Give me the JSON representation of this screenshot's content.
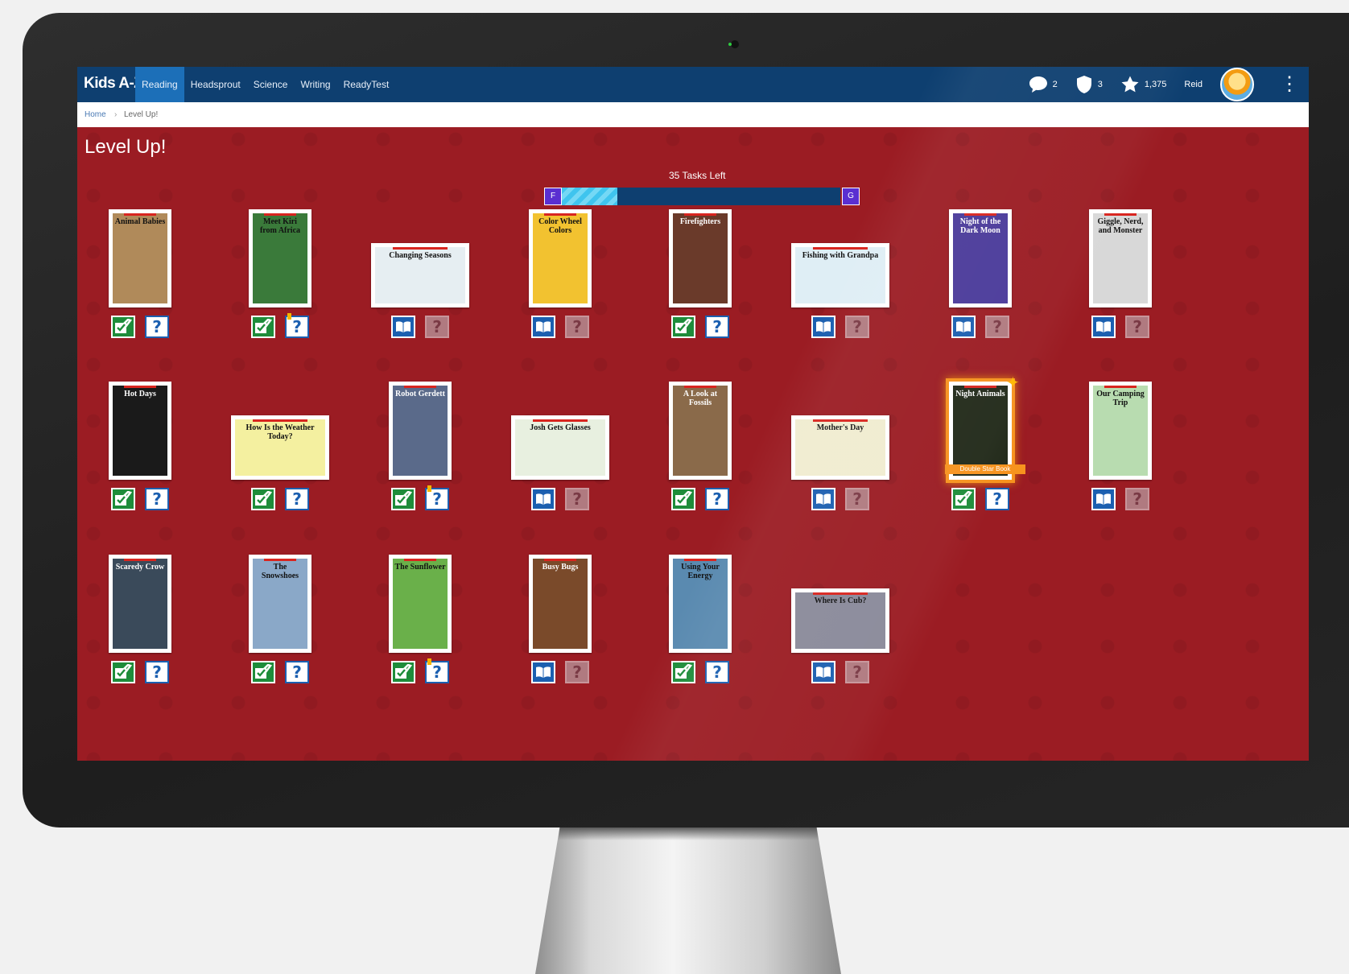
{
  "app": {
    "logo": "Kids A-Z",
    "nav": [
      "Reading",
      "Headsprout",
      "Science",
      "Writing",
      "ReadyTest"
    ],
    "active_nav": 0
  },
  "user": {
    "messages": "2",
    "shields": "3",
    "stars": "1,375",
    "name": "Reid"
  },
  "breadcrumb": {
    "home": "Home",
    "separator": "›",
    "current": "Level Up!"
  },
  "page": {
    "title": "Level Up!",
    "tasks_left": "35 Tasks Left"
  },
  "progress": {
    "from_level": "F",
    "to_level": "G",
    "fraction": 0.2
  },
  "special_tag": "Double Star Book",
  "icons": {
    "done": "check-book-icon",
    "read": "open-book-icon",
    "quiz": "question-icon"
  },
  "colors": {
    "nav": "#0e3f70",
    "accent": "#1c6fb8",
    "background": "#9b1c23",
    "done": "#1e8c3a"
  },
  "books": [
    {
      "title": "Animal Babies",
      "orientation": "portrait",
      "read_done": true,
      "quiz_active": true,
      "flag": false,
      "special": false,
      "bg": "#b08a5a"
    },
    {
      "title": "Meet Kiri from Africa",
      "orientation": "portrait",
      "read_done": true,
      "quiz_active": true,
      "flag": true,
      "special": false,
      "bg": "#3a7a3a"
    },
    {
      "title": "Changing Seasons",
      "orientation": "landscape",
      "read_done": false,
      "quiz_active": false,
      "flag": false,
      "special": false,
      "bg": "#e6eef2"
    },
    {
      "title": "Color Wheel Colors",
      "orientation": "portrait",
      "read_done": false,
      "quiz_active": false,
      "flag": false,
      "special": false,
      "bg": "#f2c230"
    },
    {
      "title": "Firefighters",
      "orientation": "portrait",
      "read_done": true,
      "quiz_active": true,
      "flag": false,
      "special": false,
      "bg": "#6a3a2a"
    },
    {
      "title": "Fishing with Grandpa",
      "orientation": "landscape",
      "read_done": false,
      "quiz_active": false,
      "flag": false,
      "special": false,
      "bg": "#dfeef5"
    },
    {
      "title": "Night of the Dark Moon",
      "orientation": "portrait",
      "read_done": false,
      "quiz_active": false,
      "flag": false,
      "special": false,
      "bg": "#4a3a9a"
    },
    {
      "title": "Giggle, Nerd, and Monster",
      "orientation": "portrait",
      "read_done": false,
      "quiz_active": false,
      "flag": false,
      "special": false,
      "bg": "#d8d8d8"
    },
    {
      "title": "Hot Days",
      "orientation": "portrait",
      "read_done": true,
      "quiz_active": true,
      "flag": false,
      "special": false,
      "bg": "#1a1a1a"
    },
    {
      "title": "How Is the Weather Today?",
      "orientation": "landscape",
      "read_done": true,
      "quiz_active": true,
      "flag": false,
      "special": false,
      "bg": "#f4f0a0"
    },
    {
      "title": "Robot Gerdett",
      "orientation": "portrait",
      "read_done": true,
      "quiz_active": true,
      "flag": true,
      "special": false,
      "bg": "#5a6a8a"
    },
    {
      "title": "Josh Gets Glasses",
      "orientation": "landscape",
      "read_done": false,
      "quiz_active": false,
      "flag": false,
      "special": false,
      "bg": "#e8f0e0"
    },
    {
      "title": "A Look at Fossils",
      "orientation": "portrait",
      "read_done": true,
      "quiz_active": true,
      "flag": false,
      "special": false,
      "bg": "#8a6a4a"
    },
    {
      "title": "Mother's Day",
      "orientation": "landscape",
      "read_done": false,
      "quiz_active": false,
      "flag": false,
      "special": false,
      "bg": "#f0ecd0"
    },
    {
      "title": "Night Animals",
      "orientation": "portrait",
      "read_done": true,
      "quiz_active": true,
      "flag": false,
      "special": true,
      "bg": "#222a1a"
    },
    {
      "title": "Our Camping Trip",
      "orientation": "portrait",
      "read_done": false,
      "quiz_active": false,
      "flag": false,
      "special": false,
      "bg": "#b8dcb0"
    },
    {
      "title": "Scaredy Crow",
      "orientation": "portrait",
      "read_done": true,
      "quiz_active": true,
      "flag": false,
      "special": false,
      "bg": "#3a4a5a"
    },
    {
      "title": "The Snowshoes",
      "orientation": "portrait",
      "read_done": true,
      "quiz_active": true,
      "flag": false,
      "special": false,
      "bg": "#8aa8c8"
    },
    {
      "title": "The Sunflower",
      "orientation": "portrait",
      "read_done": true,
      "quiz_active": true,
      "flag": true,
      "special": false,
      "bg": "#6ab04a"
    },
    {
      "title": "Busy Bugs",
      "orientation": "portrait",
      "read_done": false,
      "quiz_active": false,
      "flag": false,
      "special": false,
      "bg": "#7a4a2a"
    },
    {
      "title": "Using Your Energy",
      "orientation": "portrait",
      "read_done": true,
      "quiz_active": true,
      "flag": false,
      "special": false,
      "bg": "#5a8ab0"
    },
    {
      "title": "Where Is Cub?",
      "orientation": "landscape",
      "read_done": false,
      "quiz_active": false,
      "flag": false,
      "special": false,
      "bg": "#8a8a9a"
    }
  ]
}
